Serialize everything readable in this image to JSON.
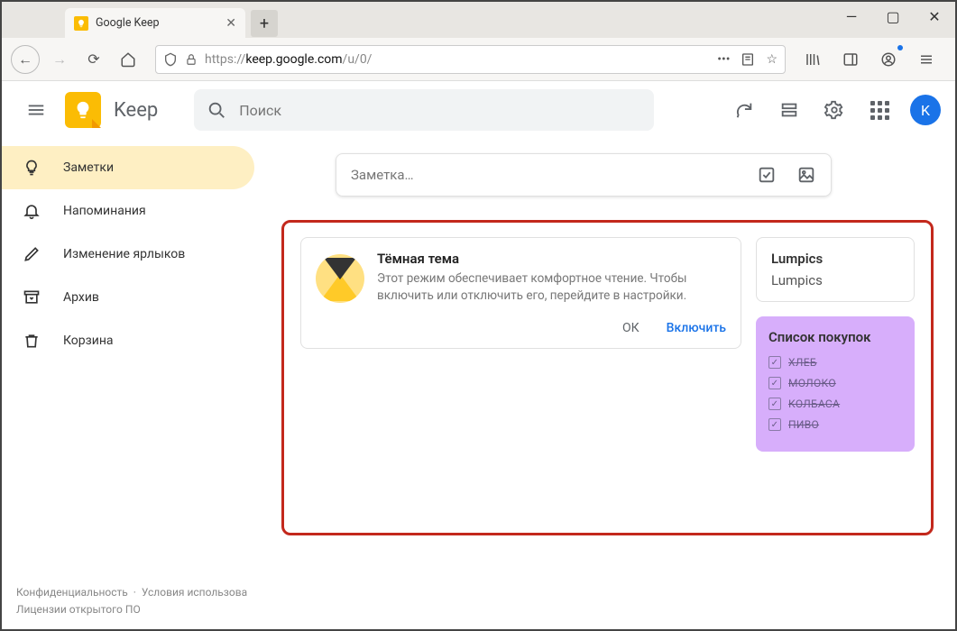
{
  "browser": {
    "tab_title": "Google Keep",
    "url_proto": "https://",
    "url_domain": "keep.google.com",
    "url_path": "/u/0/"
  },
  "header": {
    "app_title": "Keep",
    "search_placeholder": "Поиск",
    "avatar_initial": "K"
  },
  "sidebar": {
    "items": [
      {
        "label": "Заметки",
        "icon": "bulb"
      },
      {
        "label": "Напоминания",
        "icon": "bell"
      },
      {
        "label": "Изменение ярлыков",
        "icon": "pencil"
      },
      {
        "label": "Архив",
        "icon": "archive"
      },
      {
        "label": "Корзина",
        "icon": "trash"
      }
    ]
  },
  "newnote": {
    "placeholder": "Заметка…"
  },
  "dark_promo": {
    "title": "Тёмная тема",
    "desc": "Этот режим обеспечивает комфортное чтение. Чтобы включить или отключить его, перейдите в настройки.",
    "ok": "ОК",
    "enable": "Включить"
  },
  "lumpics": {
    "title": "Lumpics",
    "body": "Lumpics"
  },
  "shopping": {
    "title": "Список покупок",
    "items": [
      "ХЛЕБ",
      "МОЛОКО",
      "КОЛБАСА",
      "ПИВО"
    ]
  },
  "footer": {
    "privacy": "Конфиденциальность",
    "terms": "Условия использова",
    "license": "Лицензии открытого ПО"
  }
}
